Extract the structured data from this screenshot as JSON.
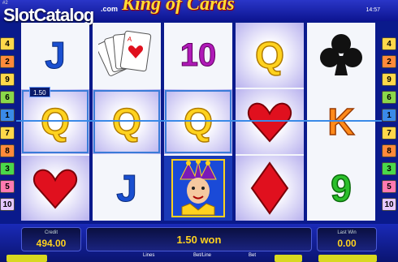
{
  "header": {
    "brand": "SlotCatalog",
    "brand_suffix": ".com",
    "brand_sup": "#2",
    "title": "King of Cards",
    "clock": "14:57"
  },
  "lines_left": [
    {
      "n": "4",
      "color": "#ffd84a"
    },
    {
      "n": "2",
      "color": "#ff8a3a"
    },
    {
      "n": "9",
      "color": "#ffd84a"
    },
    {
      "n": "6",
      "color": "#8ad84a"
    },
    {
      "n": "1",
      "color": "#3a8ae8"
    },
    {
      "n": "7",
      "color": "#ffd84a"
    },
    {
      "n": "8",
      "color": "#ff8a3a"
    },
    {
      "n": "3",
      "color": "#4ad84a"
    },
    {
      "n": "5",
      "color": "#ff7ab0"
    },
    {
      "n": "10",
      "color": "#e6c8ff"
    }
  ],
  "lines_right": [
    {
      "n": "4",
      "color": "#ffd84a"
    },
    {
      "n": "2",
      "color": "#ff8a3a"
    },
    {
      "n": "9",
      "color": "#ffd84a"
    },
    {
      "n": "6",
      "color": "#8ad84a"
    },
    {
      "n": "1",
      "color": "#3a8ae8"
    },
    {
      "n": "7",
      "color": "#ffd84a"
    },
    {
      "n": "8",
      "color": "#ff8a3a"
    },
    {
      "n": "3",
      "color": "#4ad84a"
    },
    {
      "n": "5",
      "color": "#ff7ab0"
    },
    {
      "n": "10",
      "color": "#e6c8ff"
    }
  ],
  "reels": [
    [
      "J",
      "Q",
      "heart"
    ],
    [
      "king-of-cards-fan",
      "Q",
      "J"
    ],
    [
      "10",
      "Q",
      "joker"
    ],
    [
      "Q",
      "heart",
      "diamond"
    ],
    [
      "club",
      "K",
      "9"
    ]
  ],
  "win_tag": "1.50",
  "bottom": {
    "credit_label": "Credit",
    "credit_value": "494.00",
    "message": "1.50 won",
    "last_win_label": "Last Win",
    "last_win_value": "0.00",
    "lines_label": "Lines",
    "betline_label": "Bet/Line",
    "bet_label": "Bet"
  }
}
